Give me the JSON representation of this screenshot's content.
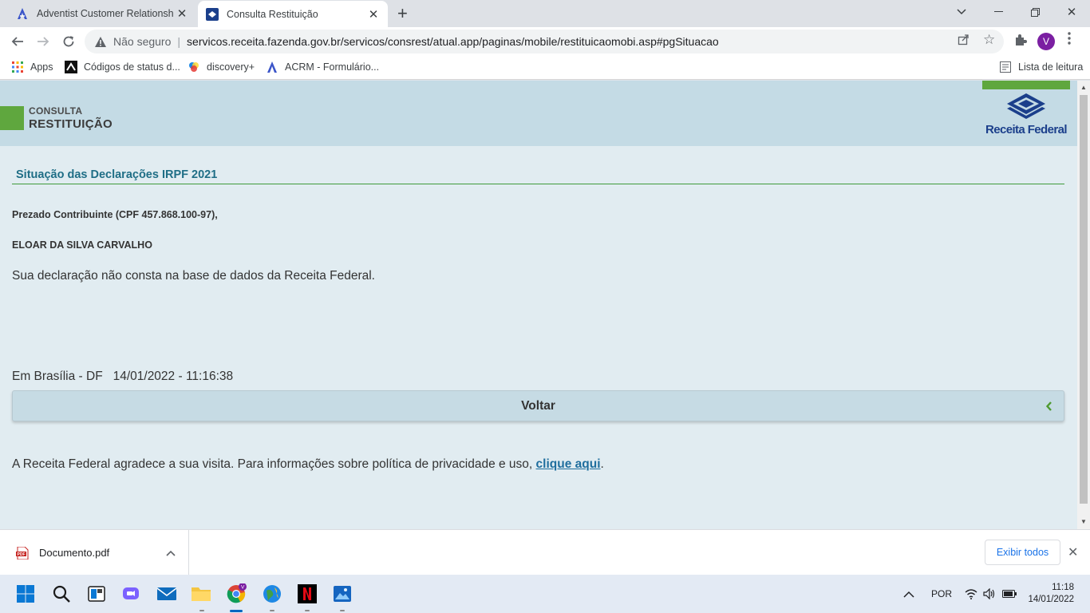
{
  "browser": {
    "tabs": [
      {
        "title": "Adventist Customer Relationship",
        "active": false
      },
      {
        "title": "Consulta Restituição",
        "active": true
      }
    ],
    "address": {
      "security_label": "Não seguro",
      "url": "servicos.receita.fazenda.gov.br/servicos/consrest/atual.app/paginas/mobile/restituicaomobi.asp#pgSituacao"
    },
    "profile_initial": "V",
    "bookmarks": [
      {
        "label": "Apps"
      },
      {
        "label": "Códigos de status d..."
      },
      {
        "label": "discovery+"
      },
      {
        "label": "ACRM - Formulário..."
      }
    ],
    "reading_list": "Lista de leitura"
  },
  "page": {
    "header": {
      "line1": "CONSULTA",
      "line2": "RESTITUIÇÃO",
      "logo_text": "Receita Federal"
    },
    "section_title": "Situação das Declarações IRPF 2021",
    "greeting": "Prezado Contribuinte (CPF 457.868.100-97),",
    "name": "ELOAR DA SILVA CARVALHO",
    "message": "Sua declaração não consta na base de dados da Receita Federal.",
    "place_date": "Em Brasília - DF   14/01/2022 - 11:16:38",
    "back_button": "Voltar",
    "footer_text": "A Receita Federal agradece a sua visita. Para informações sobre política de privacidade e uso, ",
    "footer_link": "clique aqui",
    "footer_end": "."
  },
  "downloads": {
    "file": "Documento.pdf",
    "show_all": "Exibir todos"
  },
  "taskbar": {
    "language": "POR",
    "time": "11:18",
    "date": "14/01/2022"
  },
  "colors": {
    "green": "#5fa73e",
    "header_bg": "#c4dbe5",
    "page_bg": "#e1ecf1",
    "title_blue": "#1f6e86",
    "logo_blue": "#1b3f8b"
  }
}
